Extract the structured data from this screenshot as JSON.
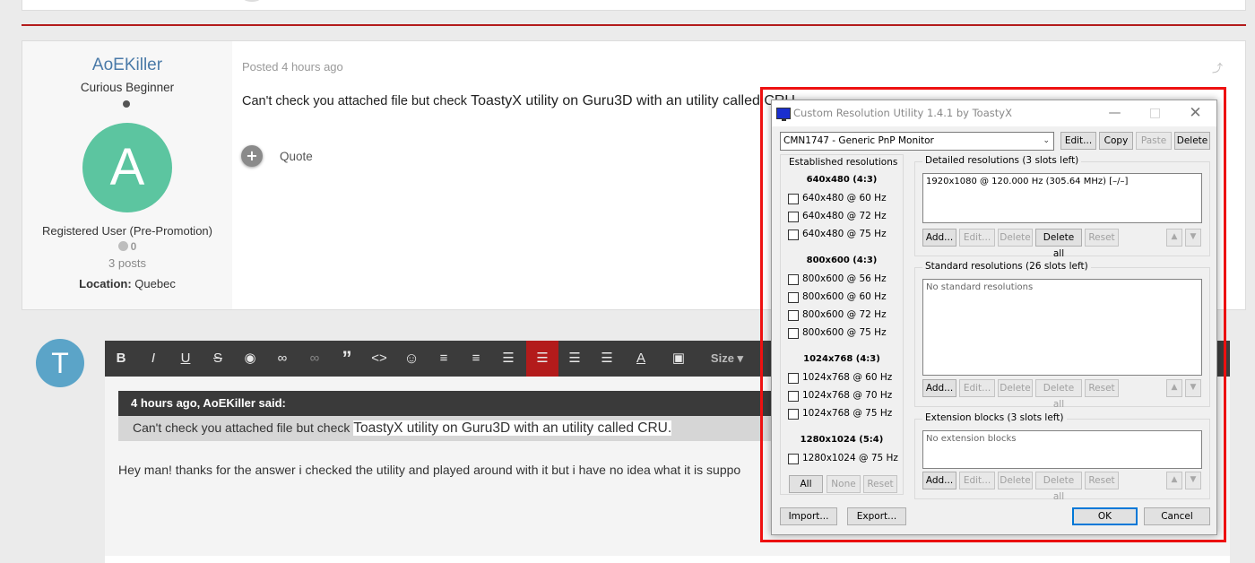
{
  "post": {
    "author": "AoEKiller",
    "rank": "Curious Beginner",
    "avatar_letter": "A",
    "group": "Registered User (Pre-Promotion)",
    "reputation": "0",
    "posts": "3 posts",
    "location_label": "Location:",
    "location_value": "Quebec",
    "posted_prefix": "Posted",
    "posted_time": "4 hours ago",
    "body_a": "Can't check you attached file but check ",
    "body_b": "ToastyX utility on Guru3D with an utility called CRU.",
    "quote_label": "Quote"
  },
  "reply": {
    "avatar_letter": "T",
    "toolbar": {
      "bold": "B",
      "italic": "I",
      "underline": "U",
      "strike": "S",
      "size": "Size"
    },
    "quote_header": "4 hours ago, AoEKiller said:",
    "quote_a": "Can't check you attached file but check ",
    "quote_b": "ToastyX utility on Guru3D with an utility called CRU.",
    "text": "Hey man! thanks for the answer i checked the utility and played around with it but i have no idea what it is suppo"
  },
  "cru": {
    "title": "Custom Resolution Utility 1.4.1 by ToastyX",
    "monitor": "CMN1747 - Generic PnP Monitor",
    "top_buttons": [
      "Edit...",
      "Copy",
      "Paste",
      "Delete"
    ],
    "established_title": "Established resolutions",
    "established_groups": [
      {
        "head": "640x480 (4:3)",
        "items": [
          "640x480 @ 60 Hz",
          "640x480 @ 72 Hz",
          "640x480 @ 75 Hz"
        ]
      },
      {
        "head": "800x600 (4:3)",
        "items": [
          "800x600 @ 56 Hz",
          "800x600 @ 60 Hz",
          "800x600 @ 72 Hz",
          "800x600 @ 75 Hz"
        ]
      },
      {
        "head": "1024x768 (4:3)",
        "items": [
          "1024x768 @ 60 Hz",
          "1024x768 @ 70 Hz",
          "1024x768 @ 75 Hz"
        ]
      },
      {
        "head": "1280x1024 (5:4)",
        "items": [
          "1280x1024 @ 75 Hz"
        ]
      }
    ],
    "est_buttons": [
      "All",
      "None",
      "Reset"
    ],
    "detailed_title": "Detailed resolutions (3 slots left)",
    "detailed_item": "1920x1080 @ 120.000 Hz (305.64 MHz) [–/–]",
    "standard_title": "Standard resolutions (26 slots left)",
    "standard_empty": "No standard resolutions",
    "extension_title": "Extension blocks (3 slots left)",
    "extension_empty": "No extension blocks",
    "group_buttons": [
      "Add...",
      "Edit...",
      "Delete",
      "Delete all",
      "Reset"
    ],
    "import": "Import...",
    "export": "Export...",
    "ok": "OK",
    "cancel": "Cancel"
  }
}
